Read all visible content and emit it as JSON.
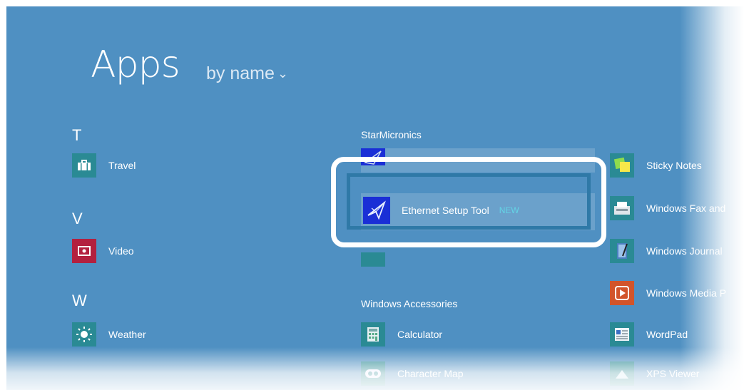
{
  "header": {
    "title": "Apps",
    "sort_label": "by name"
  },
  "groups": {
    "t": "T",
    "v": "V",
    "w": "W",
    "starmicronics": "StarMicronics",
    "windows_accessories": "Windows Accessories"
  },
  "apps": {
    "travel": "Travel",
    "video": "Video",
    "weather": "Weather",
    "ethernet_setup_tool": "Ethernet Setup Tool",
    "new_badge": "NEW",
    "calculator": "Calculator",
    "character_map": "Character Map",
    "sticky_notes": "Sticky Notes",
    "windows_fax": "Windows Fax and",
    "windows_journal": "Windows Journal",
    "windows_media": "Windows Media P",
    "wordpad": "WordPad",
    "xps_viewer": "XPS Viewer"
  },
  "colors": {
    "background": "#4f90c2",
    "tile_teal": "#2a8a94",
    "tile_red": "#b3203f",
    "tile_blue": "#1a2fd6",
    "tile_orange": "#d2542a",
    "callout_white": "#ffffff",
    "callout_blue": "#2f79a7",
    "new_badge": "#63d4e6"
  }
}
